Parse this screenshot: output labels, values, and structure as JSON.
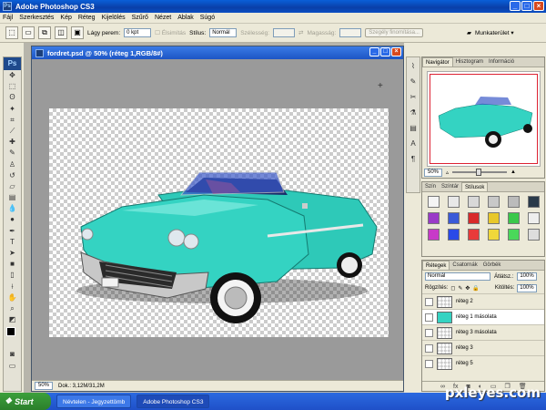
{
  "titlebar": {
    "title": "Adobe Photoshop CS3"
  },
  "menu": [
    "Fájl",
    "Szerkesztés",
    "Kép",
    "Réteg",
    "Kijelölés",
    "Szűrő",
    "Nézet",
    "Ablak",
    "Súgó"
  ],
  "options": {
    "feather_label": "Lágy perem:",
    "feather_value": "0 kpt",
    "antialias_label": "Élsimítás",
    "style_label": "Stílus:",
    "style_value": "Normál",
    "width_label": "Szélesség:",
    "height_label": "Magasság:",
    "refine_button": "Szegély finomítása...",
    "workspace_label": "Munkaterület ▾"
  },
  "document": {
    "title": "fordret.psd @ 50% (réteg 1,RGB/8#)",
    "zoom": "50%",
    "doc_size": "Dok.: 3,12M/31,2M"
  },
  "navigator": {
    "tabs": [
      "Navigátor",
      "Hisztogram",
      "Információ"
    ],
    "zoom": "50%"
  },
  "color_panel": {
    "tabs": [
      "Szín",
      "Színtár",
      "Stílusok"
    ]
  },
  "layers_panel": {
    "tabs": [
      "Rétegek",
      "Csatornák",
      "Görbék"
    ],
    "blend_mode": "Normál",
    "opacity_label": "Átlátsz.:",
    "opacity_value": "100%",
    "lock_label": "Rögzítés:",
    "fill_label": "Kitöltés:",
    "fill_value": "100%",
    "layers": [
      "réteg 2",
      "réteg 1 másolata",
      "réteg 3 másolata",
      "réteg 3",
      "réteg 5"
    ]
  },
  "taskbar": {
    "start": "Start",
    "items": [
      "Névtelen - Jegyzettömb",
      "Adobe Photoshop CS3"
    ]
  },
  "watermark": "pxleyes.com",
  "colors": {
    "car_body": "#2ec9b8",
    "title_blue": "#0a4fc3"
  }
}
